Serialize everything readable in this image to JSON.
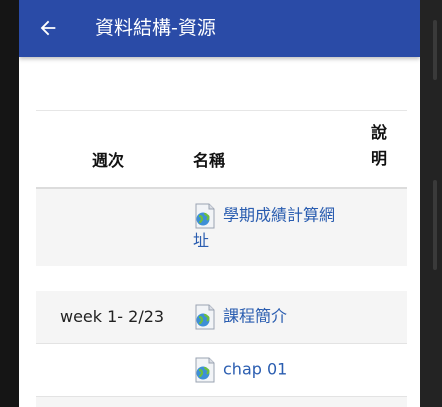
{
  "appbar": {
    "title": "資料結構-資源",
    "back_icon": "arrow-left-icon"
  },
  "table": {
    "headers": {
      "week": "週次",
      "name": "名稱",
      "description": "說明"
    },
    "rows": [
      {
        "week": "",
        "name": "學期成績計算網址",
        "description": ""
      },
      {
        "week": "week 1- 2/23",
        "name": "課程簡介",
        "description": ""
      },
      {
        "week": "",
        "name": "chap 01",
        "description": ""
      }
    ]
  },
  "colors": {
    "appbar": "#2a4ba7",
    "link": "#2a5db0",
    "row_alt": "#f5f5f5"
  },
  "icons": {
    "resource": "document-globe-icon"
  }
}
